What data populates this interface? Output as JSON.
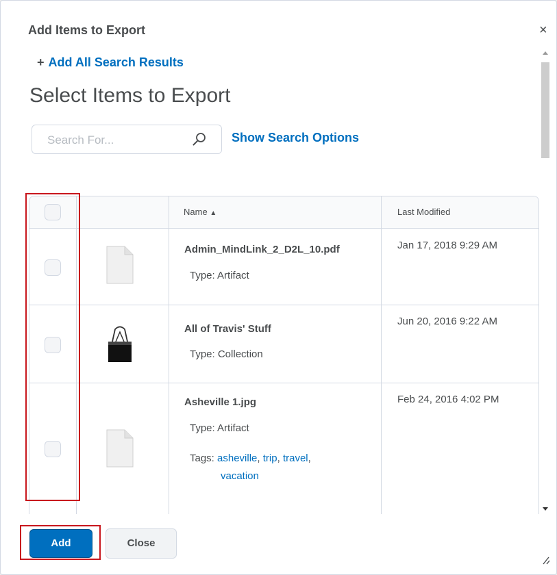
{
  "dialog": {
    "title": "Add Items to Export",
    "close_glyph": "×"
  },
  "add_all": {
    "plus": "+",
    "label": "Add All Search Results"
  },
  "heading": "Select Items to Export",
  "search": {
    "placeholder": "Search For...",
    "value": "",
    "show_options_label": "Show Search Options"
  },
  "table": {
    "columns": {
      "name": "Name",
      "sort_indicator": "▲",
      "last_modified": "Last Modified"
    },
    "rows": [
      {
        "name": "Admin_MindLink_2_D2L_10.pdf",
        "type": "Type: Artifact",
        "modified": "Jan 17, 2018 9:29 AM",
        "icon": "document-icon"
      },
      {
        "name": "All of Travis' Stuff",
        "type": "Type: Collection",
        "modified": "Jun 20, 2016 9:22 AM",
        "icon": "binder-clip-icon"
      },
      {
        "name": "Asheville 1.jpg",
        "type": "Type: Artifact",
        "modified": "Feb 24, 2016 4:02 PM",
        "icon": "document-icon",
        "tags_label": "Tags:",
        "tags": [
          "asheville",
          "trip",
          "travel",
          "vacation"
        ]
      }
    ]
  },
  "footer": {
    "add_label": "Add",
    "close_label": "Close"
  },
  "colors": {
    "link": "#006fbf",
    "primary_button": "#006fbf",
    "highlight": "#c8161d",
    "text": "#494c4e",
    "border": "#d3d9e3"
  }
}
